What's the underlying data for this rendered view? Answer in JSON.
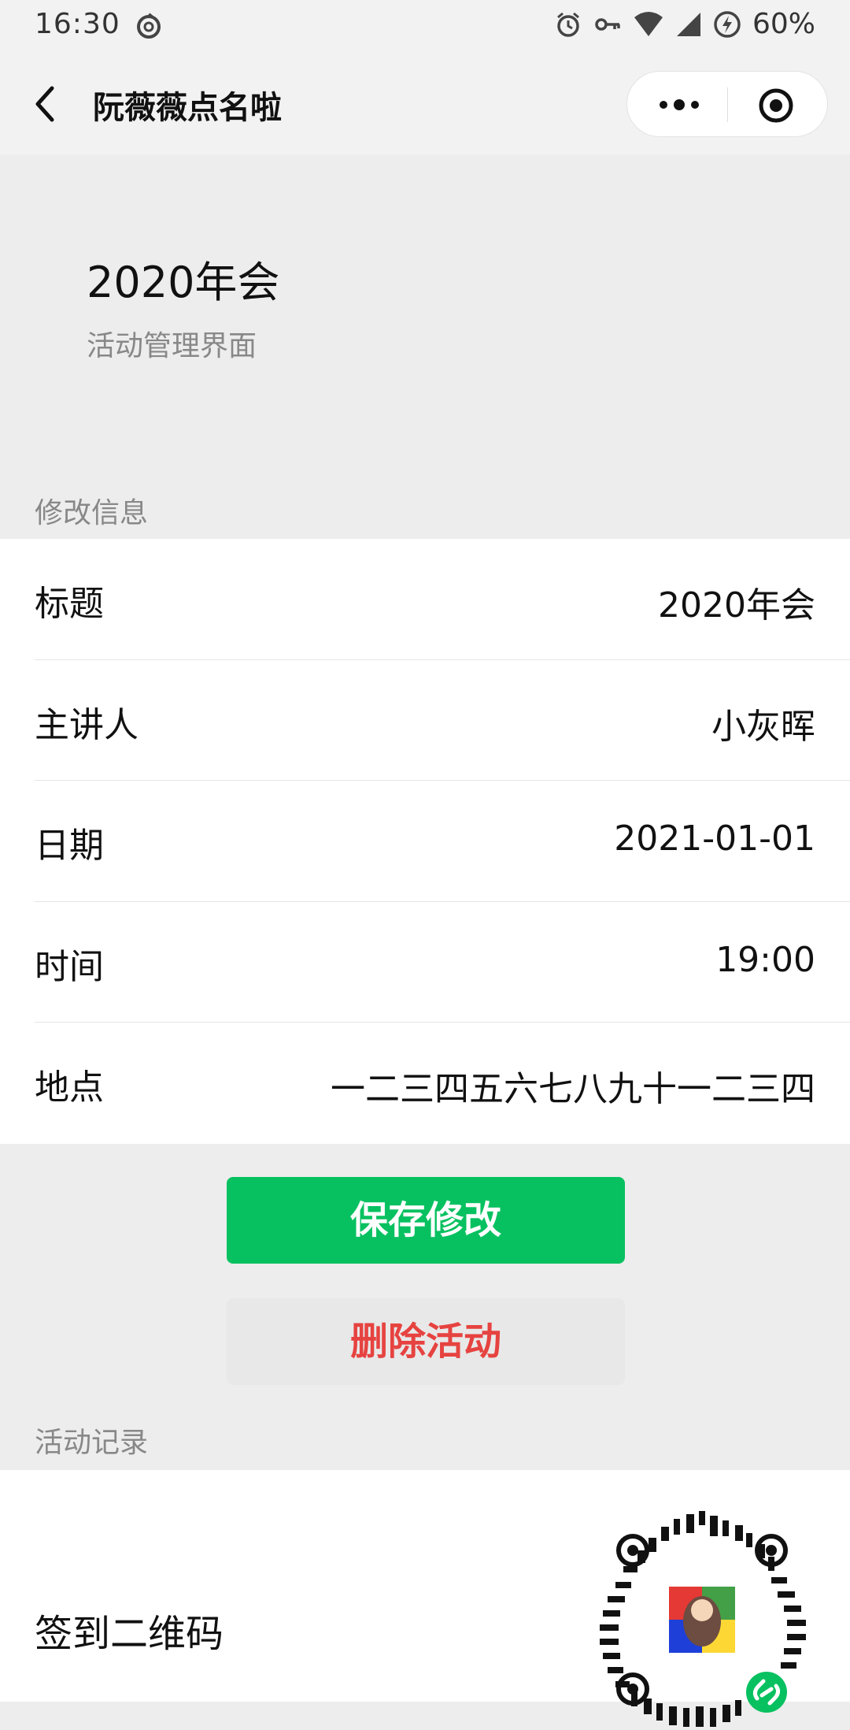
{
  "status_bar": {
    "time": "16:30",
    "battery": "60%",
    "icons": [
      "netease-music-icon",
      "alarm-icon",
      "key-icon",
      "wifi-icon",
      "signal-icon",
      "battery-charging-icon"
    ]
  },
  "nav": {
    "title": "阮薇薇点名啦",
    "back_icon": "chevron-left-icon",
    "more_icon": "more-dots-icon",
    "close_icon": "target-icon"
  },
  "header": {
    "title": "2020年会",
    "subtitle": "活动管理界面"
  },
  "edit_section": {
    "label": "修改信息",
    "rows": [
      {
        "label": "标题",
        "value": "2020年会"
      },
      {
        "label": "主讲人",
        "value": "小灰晖"
      },
      {
        "label": "日期",
        "value": "2021-01-01"
      },
      {
        "label": "时间",
        "value": "19:00"
      },
      {
        "label": "地点",
        "value": "一二三四五六七八九十一二三四"
      }
    ]
  },
  "actions": {
    "save_label": "保存修改",
    "delete_label": "删除活动"
  },
  "record_section": {
    "label": "活动记录",
    "qr_label": "签到二维码"
  },
  "colors": {
    "primary_green": "#07c160",
    "danger_red": "#e64340",
    "background": "#ededed"
  }
}
